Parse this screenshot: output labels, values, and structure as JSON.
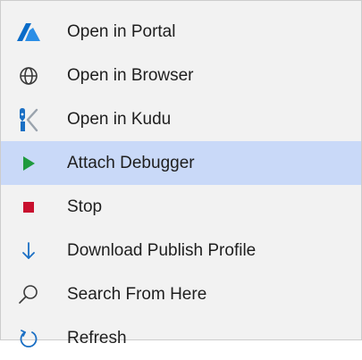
{
  "menu": {
    "items": [
      {
        "label": "Open in Portal",
        "icon": "azure-logo-icon"
      },
      {
        "label": "Open in Browser",
        "icon": "globe-icon"
      },
      {
        "label": "Open in Kudu",
        "icon": "kudu-icon"
      },
      {
        "label": "Attach Debugger",
        "icon": "play-icon",
        "highlighted": true
      },
      {
        "label": "Stop",
        "icon": "stop-icon"
      },
      {
        "label": "Download Publish Profile",
        "icon": "download-arrow-icon"
      },
      {
        "label": "Search From Here",
        "icon": "search-icon"
      },
      {
        "label": "Refresh",
        "icon": "refresh-icon"
      }
    ]
  },
  "colors": {
    "menu_background": "#f2f2f2",
    "highlight": "#c9d9f8",
    "azure_blue": "#0a6cc8",
    "icon_blue": "#1a6fc4",
    "play_green": "#1e9a3e",
    "stop_red": "#c8102e",
    "icon_gray": "#3a3a3a",
    "text": "#1e1e1e"
  }
}
